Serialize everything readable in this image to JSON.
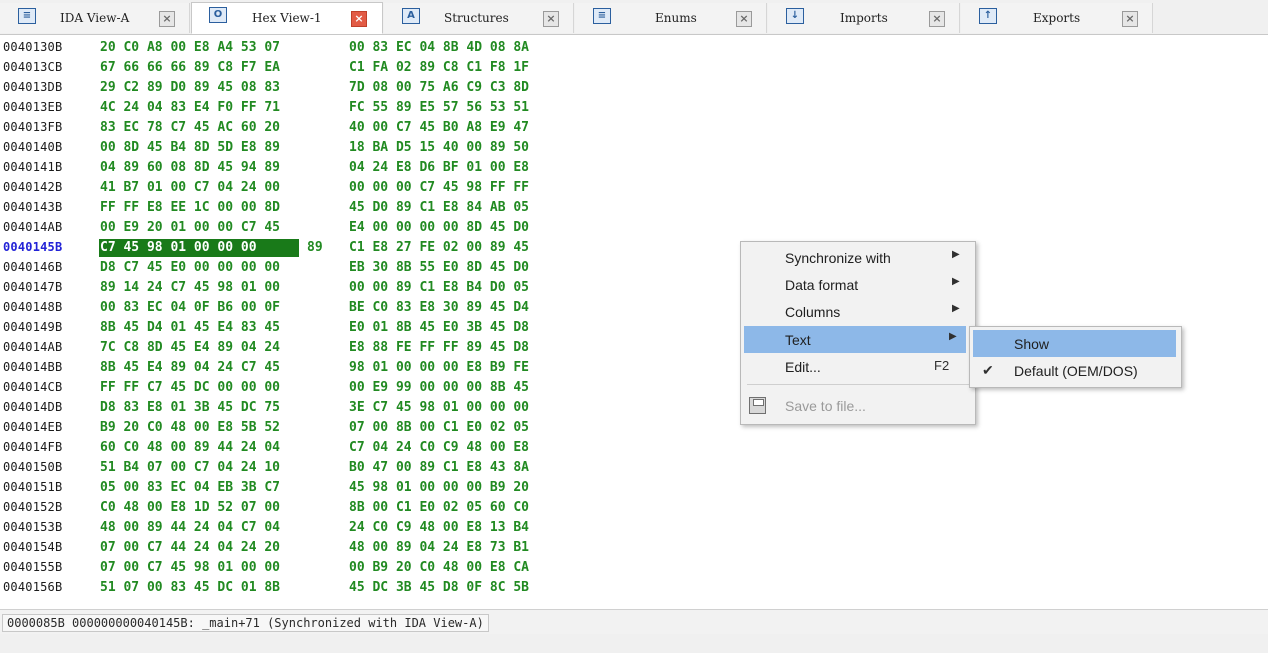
{
  "tabs": [
    {
      "label": "IDA View-A",
      "icon": "ida-view-icon",
      "active": false
    },
    {
      "label": "Hex View-1",
      "icon": "hex-view-icon",
      "active": true
    },
    {
      "label": "Structures",
      "icon": "structures-icon",
      "active": false
    },
    {
      "label": "Enums",
      "icon": "enums-icon",
      "active": false
    },
    {
      "label": "Imports",
      "icon": "imports-icon",
      "active": false
    },
    {
      "label": "Exports",
      "icon": "exports-icon",
      "active": false
    }
  ],
  "hex_rows": [
    {
      "addr": "0040130B",
      "b1": "20 C0 A8 00 E8 A4 53 07",
      "b2": "00 83 EC 04 8B 4D 08 8A"
    },
    {
      "addr": "004013CB",
      "b1": "67 66 66 66 89 C8 F7 EA",
      "b2": "C1 FA 02 89 C8 C1 F8 1F"
    },
    {
      "addr": "004013DB",
      "b1": "29 C2 89 D0 89 45 08 83",
      "b2": "7D 08 00 75 A6 C9 C3 8D"
    },
    {
      "addr": "004013EB",
      "b1": "4C 24 04 83 E4 F0 FF 71",
      "b2": "FC 55 89 E5 57 56 53 51"
    },
    {
      "addr": "004013FB",
      "b1": "83 EC 78 C7 45 AC 60 20",
      "b2": "40 00 C7 45 B0 A8 E9 47"
    },
    {
      "addr": "0040140B",
      "b1": "00 8D 45 B4 8D 5D E8 89",
      "b2": "18 BA D5 15 40 00 89 50"
    },
    {
      "addr": "0040141B",
      "b1": "04 89 60 08 8D 45 94 89",
      "b2": "04 24 E8 D6 BF 01 00 E8"
    },
    {
      "addr": "0040142B",
      "b1": "41 B7 01 00 C7 04 24 00",
      "b2": "00 00 00 C7 45 98 FF FF"
    },
    {
      "addr": "0040143B",
      "b1": "FF FF E8 EE 1C 00 00 8D",
      "b2": "45 D0 89 C1 E8 84 AB 05"
    },
    {
      "addr": "004014AB",
      "b1": "00 E9 20 01 00 00 C7 45",
      "b2": "E4 00 00 00 00 8D 45 D0"
    },
    {
      "addr": "0040145B",
      "b1": "C7 45 98 01 00 00 00 89",
      "b2": "C1 E8 27 FE 02 00 89 45",
      "selected": "C7 45 98 01 00 00 00",
      "selected_rest": "89"
    },
    {
      "addr": "0040146B",
      "b1": "D8 C7 45 E0 00 00 00 00",
      "b2": "EB 30 8B 55 E0 8D 45 D0"
    },
    {
      "addr": "0040147B",
      "b1": "89 14 24 C7 45 98 01 00",
      "b2": "00 00 89 C1 E8 B4 D0 05"
    },
    {
      "addr": "0040148B",
      "b1": "00 83 EC 04 0F B6 00 0F",
      "b2": "BE C0 83 E8 30 89 45 D4"
    },
    {
      "addr": "0040149B",
      "b1": "8B 45 D4 01 45 E4 83 45",
      "b2": "E0 01 8B 45 E0 3B 45 D8"
    },
    {
      "addr": "004014AB",
      "b1": "7C C8 8D 45 E4 89 04 24",
      "b2": "E8 88 FE FF FF 89 45 D8"
    },
    {
      "addr": "004014BB",
      "b1": "8B 45 E4 89 04 24 C7 45",
      "b2": "98 01 00 00 00 E8 B9 FE"
    },
    {
      "addr": "004014CB",
      "b1": "FF FF C7 45 DC 00 00 00",
      "b2": "00 E9 99 00 00 00 8B 45"
    },
    {
      "addr": "004014DB",
      "b1": "D8 83 E8 01 3B 45 DC 75",
      "b2": "3E C7 45 98 01 00 00 00"
    },
    {
      "addr": "004014EB",
      "b1": "B9 20 C0 48 00 E8 5B 52",
      "b2": "07 00 8B 00 C1 E0 02 05"
    },
    {
      "addr": "004014FB",
      "b1": "60 C0 48 00 89 44 24 04",
      "b2": "C7 04 24 C0 C9 48 00 E8"
    },
    {
      "addr": "0040150B",
      "b1": "51 B4 07 00 C7 04 24 10",
      "b2": "B0 47 00 89 C1 E8 43 8A"
    },
    {
      "addr": "0040151B",
      "b1": "05 00 83 EC 04 EB 3B C7",
      "b2": "45 98 01 00 00 00 B9 20"
    },
    {
      "addr": "0040152B",
      "b1": "C0 48 00 E8 1D 52 07 00",
      "b2": "8B 00 C1 E0 02 05 60 C0"
    },
    {
      "addr": "0040153B",
      "b1": "48 00 89 44 24 04 C7 04",
      "b2": "24 C0 C9 48 00 E8 13 B4"
    },
    {
      "addr": "0040154B",
      "b1": "07 00 C7 44 24 04 24 20",
      "b2": "48 00 89 04 24 E8 73 B1"
    },
    {
      "addr": "0040155B",
      "b1": "07 00 C7 45 98 01 00 00",
      "b2": "00 B9 20 C0 48 00 E8 CA"
    },
    {
      "addr": "0040156B",
      "b1": "51 07 00 83 45 DC 01 8B",
      "b2": "45 DC 3B 45 D8 0F 8C 5B"
    }
  ],
  "status": {
    "text": "0000085B 000000000040145B: _main+71 (Synchronized with IDA View-A)"
  },
  "context_menu": {
    "items": [
      {
        "label": "Synchronize with",
        "submenu": true
      },
      {
        "label": "Data format",
        "submenu": true
      },
      {
        "label": "Columns",
        "submenu": true
      },
      {
        "label": "Text",
        "submenu": true,
        "highlighted": true
      },
      {
        "label": "Edit...",
        "shortcut": "F2"
      },
      {
        "label": "Save to file...",
        "disabled": true,
        "icon": "save-icon"
      }
    ]
  },
  "text_submenu": {
    "items": [
      {
        "label": "Show",
        "highlighted": true
      },
      {
        "label": "Default (OEM/DOS)",
        "checked": true
      }
    ]
  },
  "colors": {
    "hex_bytes": "#218a21",
    "selection": "#197a19",
    "menu_highlight": "#8db8e8",
    "current_address": "#2222d6"
  }
}
